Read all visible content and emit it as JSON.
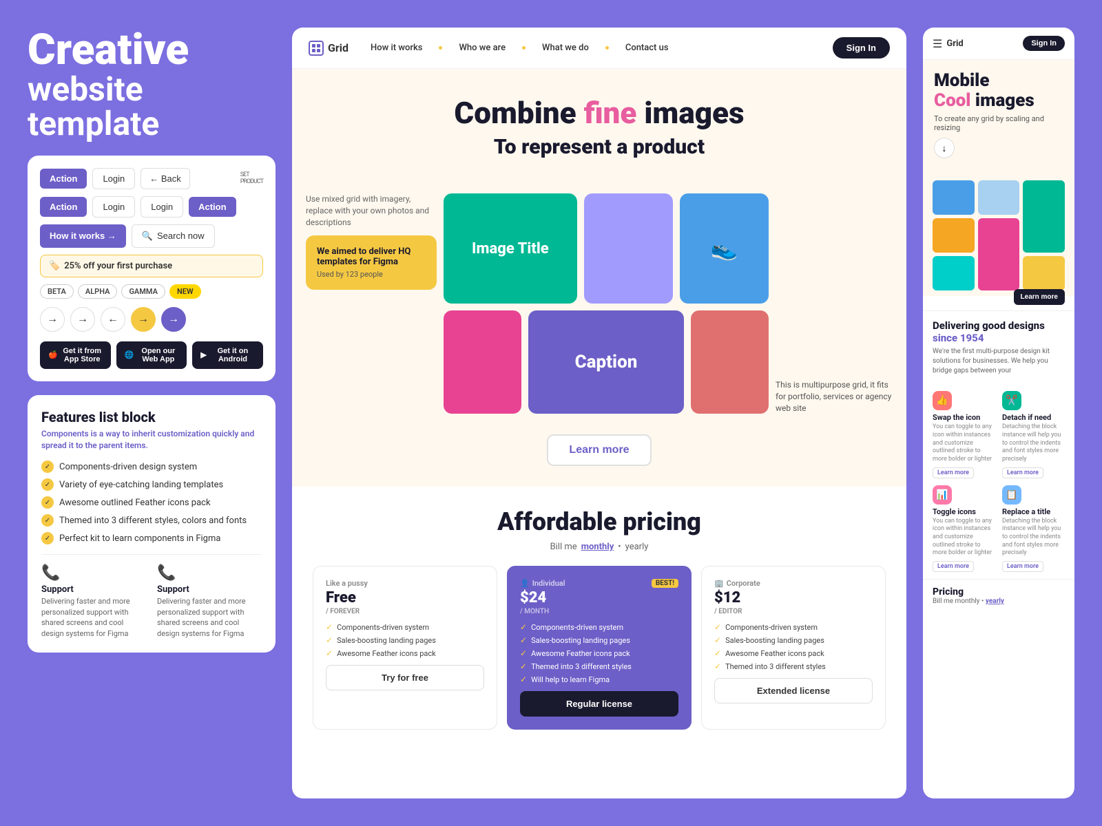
{
  "left": {
    "title": "Creative",
    "subtitle": "website template",
    "buttons": {
      "action1": "Action",
      "login1": "Login",
      "back": "← Back",
      "brand": "SET",
      "brand_sub": "PRODUCT",
      "action2": "Action",
      "login2": "Login",
      "login3": "Login",
      "action3": "Action",
      "how_it_works": "How it works →",
      "search_now": "Search now",
      "promo": "25% off your first purchase",
      "tags": [
        "BETA",
        "ALPHA",
        "GAMMA",
        "NEW"
      ],
      "app_store": "Get it from\nApp Store",
      "web_app": "Open our\nWeb App",
      "android": "Get it on\nAndroid"
    },
    "features": {
      "title": "Features list block",
      "subtitle": "Components is a way to inherit customization quickly and spread it to the parent items.",
      "items": [
        "Components-driven design system",
        "Variety of eye-catching landing templates",
        "Awesome outlined Feather icons pack",
        "Themed into 3 different styles, colors and fonts",
        "Perfect kit to learn components in Figma"
      ],
      "support": {
        "label": "Support",
        "desc": "Delivering faster and more personalized support with shared screens and cool design systems for Figma"
      }
    }
  },
  "middle": {
    "nav": {
      "logo": "Grid",
      "links": [
        "How it works",
        "Who we are",
        "What we do",
        "Contact us"
      ],
      "sign_in": "Sign In"
    },
    "hero": {
      "title_start": "Combine ",
      "title_highlight": "fine",
      "title_end": " images",
      "subtitle": "To represent a product",
      "left_text": "Use mixed grid with imagery, replace with your own photos and descriptions",
      "right_text": "This is multipurpose grid, it fits for portfolio, services or agency web site",
      "yellow_box_title": "We aimed to deliver HQ templates for Figma",
      "yellow_box_sub": "Used by 123 people",
      "image_tile_label": "Image Title",
      "caption_label": "Caption",
      "learn_more": "Learn more"
    },
    "pricing": {
      "title": "Affordable pricing",
      "billing": "Bill me",
      "monthly": "monthly",
      "yearly": "yearly",
      "plans": [
        {
          "tier": "Like a pussy",
          "name": "Free",
          "period": "/ FOREVER",
          "features": [
            "Components-driven system",
            "Sales-boosting landing pages",
            "Awesome Feather icons pack"
          ],
          "cta": "Try for free",
          "featured": false
        },
        {
          "tier": "Individual",
          "badge": "BEST!",
          "name": "$24",
          "period": "/ MONTH",
          "features": [
            "Components-driven system",
            "Sales-boosting landing pages",
            "Awesome Feather icons pack",
            "Themed into 3 different styles",
            "Will help to learn Figma"
          ],
          "cta": "Regular license",
          "featured": true
        },
        {
          "tier": "Corporate",
          "name": "$12",
          "period": "/ EDITOR",
          "features": [
            "Components-driven system",
            "Sales-boosting landing pages",
            "Awesome Feather icons pack",
            "Themed into 3 different styles"
          ],
          "cta": "Extended license",
          "featured": false
        }
      ]
    }
  },
  "right": {
    "nav": {
      "logo": "Grid",
      "sign_in": "Sign In"
    },
    "hero": {
      "title": "Mobile",
      "highlight": "Cool",
      "title2": "images",
      "sub": "To create any grid by scaling and resizing"
    },
    "since": {
      "title": "Delivering good designs",
      "year_label": "since 1954",
      "desc": "We're the first multi-purpose design kit solutions for businesses. We help you bridge gaps between    your"
    },
    "feature_icons": [
      {
        "title": "Swap the icon",
        "desc": "You can toggle to any icon within instances and customize outlined stroke to more bolder or lighter",
        "learn": "Learn more",
        "color": "fi-red"
      },
      {
        "title": "Detach if need",
        "desc": "Detaching the block instance will help you to control the indents and font styles more precisely",
        "learn": "Learn more",
        "color": "fi-green"
      },
      {
        "title": "Toggle icons",
        "desc": "You can toggle to any icon within instances and customize outlined stroke to more bolder or lighter",
        "learn": "Learn more",
        "color": "fi-pink"
      },
      {
        "title": "Replace a title",
        "desc": "Detaching the block instance will help you to control the indents and font styles more precisely",
        "learn": "Learn more",
        "color": "fi-blue"
      }
    ],
    "pricing": {
      "label": "Pricing",
      "sub": "Bill me monthly •",
      "yearly": "yearly"
    },
    "learn_more": "Learn more"
  }
}
